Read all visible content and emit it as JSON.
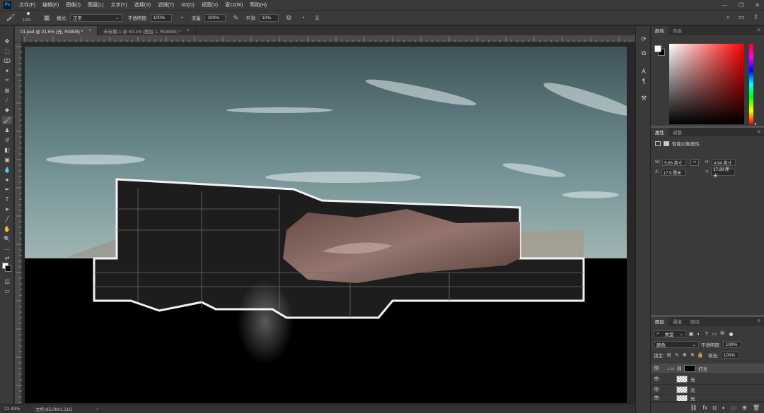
{
  "app": {
    "menu": [
      "文件(F)",
      "编辑(E)",
      "图像(I)",
      "图层(L)",
      "文字(Y)",
      "选择(S)",
      "滤镜(T)",
      "3D(D)",
      "视图(V)",
      "窗口(W)",
      "帮助(H)"
    ],
    "logo": "Ps"
  },
  "options": {
    "brush_size": "1200",
    "mode_label": "模式:",
    "mode_value": "正常",
    "opacity_label": "不透明度:",
    "opacity_value": "100%",
    "flow_label": "流量:",
    "flow_value": "100%",
    "smoothing_label": "平滑:",
    "smoothing_value": "10%"
  },
  "tabs": [
    {
      "label": "01.psd @ 21.5% (光, RGB/8) *",
      "close": "×"
    },
    {
      "label": "未标题-1 @ 50.1% (图层 1, RGB/8#) *",
      "close": "×"
    }
  ],
  "status": {
    "zoom": "21.49%",
    "doc": "文档:85.0M/1.21G",
    "arrow": "›"
  },
  "color_panel": {
    "tabs": [
      "颜色",
      "色板"
    ]
  },
  "properties_panel": {
    "tabs": [
      "属性",
      "调整"
    ],
    "title": "智能对象属性",
    "w_label": "W:",
    "w_value": "5.65 英寸",
    "h_label": "H:",
    "h_value": "4.94 英寸",
    "x_label": "X:",
    "x_value": "17.9 厘米",
    "y_label": "Y:",
    "y_value": "17.26 厘米"
  },
  "layers_panel": {
    "tabs": [
      "图层",
      "通道",
      "路径"
    ],
    "filter_kind": "类型",
    "blend_mode": "颜色",
    "opacity_label": "不透明度:",
    "opacity_value": "100%",
    "lock_label": "锁定:",
    "fill_label": "填充:",
    "fill_value": "100%",
    "layers": [
      {
        "name": "灯光",
        "type": "group"
      },
      {
        "name": "光",
        "type": "layer"
      },
      {
        "name": "光",
        "type": "layer"
      },
      {
        "name": "光",
        "type": "layer"
      }
    ]
  }
}
